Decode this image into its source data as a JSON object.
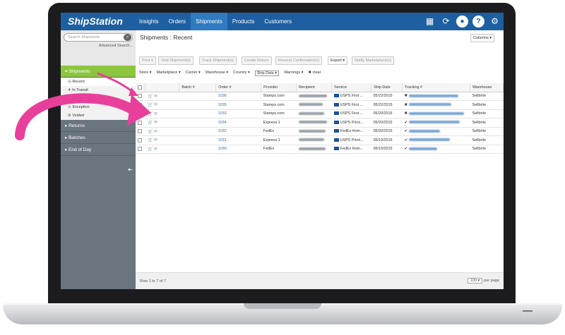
{
  "app": {
    "logo": "ShipStation",
    "nav": [
      "Insights",
      "Orders",
      "Shipments",
      "Products",
      "Customers"
    ],
    "active_nav": "Shipments",
    "top_icons": [
      "calculator-icon",
      "refresh-icon",
      "user-icon",
      "help-icon",
      "gear-icon"
    ]
  },
  "sidebar": {
    "search_placeholder": "Search Shipments",
    "advanced_search": "Advanced Search...",
    "sections": {
      "shipments": "Shipments",
      "returns": "Returns",
      "batches": "Batches",
      "end_of_day": "End of Day"
    },
    "items": [
      "Recent",
      "In Transit",
      "Delivered",
      "Exception",
      "Voided"
    ]
  },
  "main": {
    "title": "Shipments : Recent",
    "columns_button": "Columns",
    "toolbar": {
      "print": "Print",
      "void": "Void Shipment(s)",
      "track": "Track Shipment(s)",
      "create_return": "Create Return",
      "resend": "Resend Confirmation(s)",
      "export": "Export",
      "notify": "Notify Marketplace(s)"
    },
    "filters": [
      "Store",
      "Marketplace",
      "Carrier",
      "Warehouse",
      "Country",
      "Ship Date",
      "Warnings"
    ],
    "clear": "clear",
    "headers": [
      "Batch #",
      "Order #",
      "Provider",
      "Recipient",
      "Service",
      "Ship Date",
      "Tracking #",
      "Warehouse"
    ],
    "rows": [
      {
        "order": "1036",
        "provider": "Stamps.com",
        "service": "USPS First ...",
        "date": "05/22/2015",
        "track_status": "✖",
        "warehouse": "Sellbrite"
      },
      {
        "order": "1035",
        "provider": "Stamps.com",
        "service": "USPS First ...",
        "date": "05/22/2015",
        "track_status": "✖",
        "warehouse": "Sellbrite"
      },
      {
        "order": "1033",
        "provider": "Stamps.com",
        "service": "USPS First ...",
        "date": "05/20/2015",
        "track_status": "✖",
        "warehouse": "Sellbrite"
      },
      {
        "order": "1034",
        "provider": "Express 1",
        "service": "USPS Priori...",
        "date": "05/20/2015",
        "track_status": "✔",
        "warehouse": "Sellbrite"
      },
      {
        "order": "1032",
        "provider": "FedEx",
        "service": "FedEx Hom...",
        "date": "05/20/2015",
        "track_status": "✔",
        "warehouse": "Sellbrite"
      },
      {
        "order": "1031",
        "provider": "Express 1",
        "service": "USPS Priori...",
        "date": "05/19/2015",
        "track_status": "✔",
        "warehouse": "Sellbrite"
      },
      {
        "order": "1030",
        "provider": "FedEx",
        "service": "FedEx Hom...",
        "date": "05/19/2015",
        "track_status": "✔",
        "warehouse": "Sellbrite"
      }
    ],
    "footer": {
      "rows": "Row 1 to 7 of 7",
      "per_page_value": "100",
      "per_page_label": "per page"
    }
  },
  "colors": {
    "topbar": "#1d5fa1",
    "active_section": "#8cc63f",
    "arrow": "#e8409a"
  }
}
